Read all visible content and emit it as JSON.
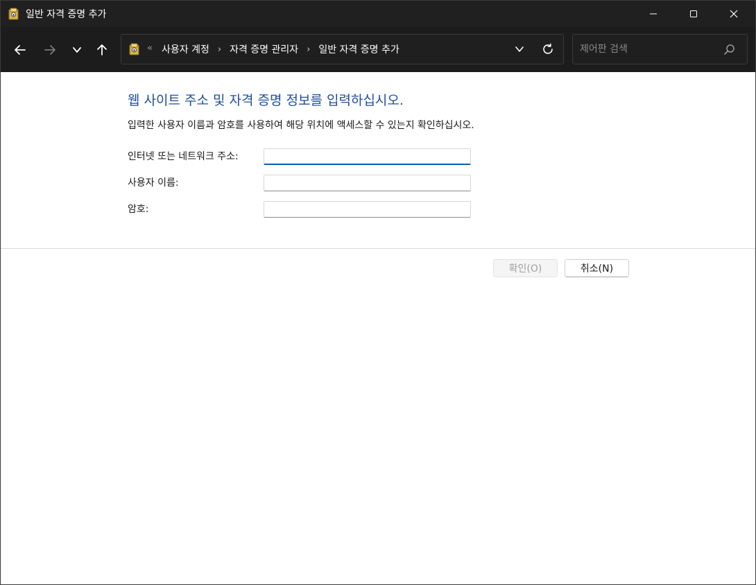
{
  "window": {
    "title": "일반 자격 증명 추가"
  },
  "nav": {
    "back_icon": "arrow-left-icon",
    "forward_icon": "arrow-right-icon",
    "recent_icon": "chevron-down-icon",
    "up_icon": "arrow-up-icon"
  },
  "address": {
    "overflow_marker": "«",
    "crumbs": [
      "사용자 계정",
      "자격 증명 관리자",
      "일반 자격 증명 추가"
    ],
    "separator": "›"
  },
  "search": {
    "placeholder": "제어판 검색"
  },
  "form": {
    "heading": "웹 사이트 주소 및 자격 증명 정보를 입력하십시오.",
    "subtext": "입력한 사용자 이름과 암호를 사용하여 해당 위치에 액세스할 수 있는지 확인하십시오.",
    "address_label": "인터넷 또는 네트워크 주소:",
    "address_value": "",
    "username_label": "사용자 이름:",
    "username_value": "",
    "password_label": "암호:",
    "password_value": ""
  },
  "buttons": {
    "ok_label": "확인(O)",
    "cancel_label": "취소(N)"
  },
  "colors": {
    "heading": "#1e4e9a",
    "focus_accent": "#005fb8",
    "titlebar": "#202020"
  }
}
